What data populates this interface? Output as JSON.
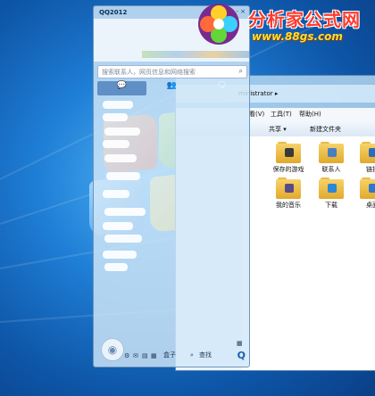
{
  "watermark": {
    "site_name": "分析家公式网",
    "site_url": "www.88gs.com"
  },
  "qq_panel": {
    "title": "QQ2012",
    "window_controls": "- ×",
    "search_placeholder": "搜索联系人，网页信息和网络搜索",
    "tabs": [
      "💬",
      "👥",
      "🗨"
    ],
    "bottom_labels": {
      "apps": "盒子",
      "find": "查找"
    },
    "brand_glyph": "Q"
  },
  "explorer": {
    "breadcrumb": "ministrator ▸",
    "menu": {
      "view": "看(V)",
      "tools": "工具(T)",
      "help": "帮助(H)"
    },
    "toolbar": {
      "share": "共享 ▾",
      "new_folder": "新建文件夹"
    },
    "folders": [
      {
        "label": "保存的游戏",
        "badge_color": "#3a3a3a"
      },
      {
        "label": "联系人",
        "badge_color": "#4a7fc2"
      },
      {
        "label": "链接",
        "badge_color": "#2e6db5"
      },
      {
        "label": "我的音乐",
        "badge_color": "#5a4a8a"
      },
      {
        "label": "下载",
        "badge_color": "#2d86d6"
      },
      {
        "label": "桌面",
        "badge_color": "#2f78c8"
      }
    ]
  },
  "colors": {
    "accent": "#5f8fc4",
    "folder": "#f0c24a"
  }
}
